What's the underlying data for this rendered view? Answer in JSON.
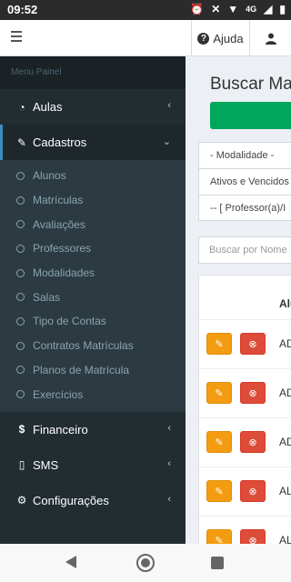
{
  "status_bar": {
    "time": "09:52",
    "signal_label": "4G"
  },
  "topbar": {
    "help_label": "Ajuda"
  },
  "sidebar": {
    "header": "Menu Painel",
    "items": [
      {
        "label": "Aulas",
        "icon": "dashboard-icon"
      },
      {
        "label": "Cadastros",
        "icon": "edit-icon",
        "expanded": true
      },
      {
        "label": "Financeiro",
        "icon": "dollar-icon"
      },
      {
        "label": "SMS",
        "icon": "mobile-icon"
      },
      {
        "label": "Configurações",
        "icon": "gear-icon"
      }
    ],
    "submenu": [
      "Alunos",
      "Matrículas",
      "Avaliações",
      "Professores",
      "Modalidades",
      "Salas",
      "Tipo de Contas",
      "Contratos Matrículas",
      "Planos de Matrícula",
      "Exercícios"
    ]
  },
  "main": {
    "title": "Buscar Ma",
    "filters": [
      "- Modalidade -",
      "Ativos e Vencidos",
      "-- [ Professor(a)/I"
    ],
    "search_placeholder": "Buscar por Nome",
    "column_header": "Alu",
    "rows": [
      "AD",
      "AD",
      "AD",
      "AL",
      "AL"
    ]
  },
  "colors": {
    "sidebar_bg": "#222d32",
    "accent_green": "#00a65a",
    "edit_orange": "#f39c12",
    "delete_red": "#dd4b39"
  }
}
